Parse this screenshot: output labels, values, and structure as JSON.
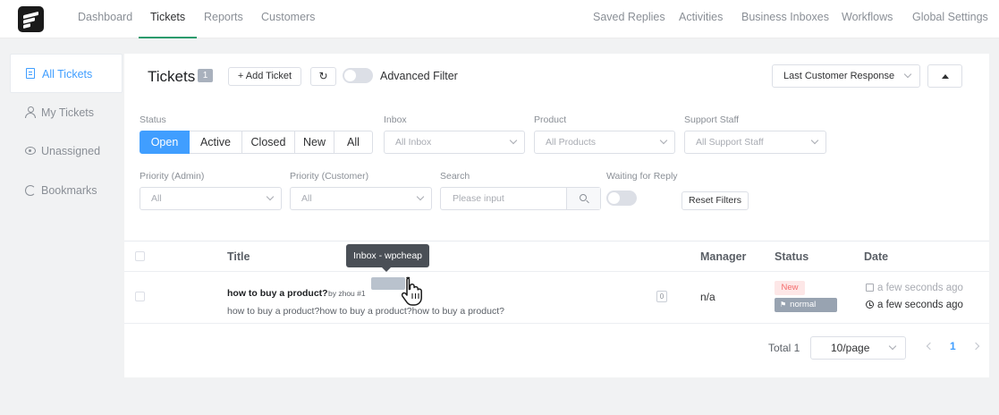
{
  "nav": {
    "items": [
      {
        "label": "Dashboard",
        "active": false
      },
      {
        "label": "Tickets",
        "active": true
      },
      {
        "label": "Reports",
        "active": false
      },
      {
        "label": "Customers",
        "active": false
      }
    ],
    "right_items": [
      {
        "label": "Saved Replies"
      },
      {
        "label": "Activities"
      },
      {
        "label": "Business Inboxes"
      },
      {
        "label": "Workflows"
      },
      {
        "label": "Global Settings"
      }
    ]
  },
  "sidebar": {
    "items": [
      {
        "label": "All Tickets",
        "icon": "document-icon",
        "active": true
      },
      {
        "label": "My Tickets",
        "icon": "user-icon",
        "active": false
      },
      {
        "label": "Unassigned",
        "icon": "eye-icon",
        "active": false
      },
      {
        "label": "Bookmarks",
        "icon": "bookmark-icon",
        "active": false
      }
    ]
  },
  "header": {
    "title": "Tickets",
    "count": "1",
    "add_ticket_label": "+ Add Ticket",
    "refresh_glyph": "↻",
    "advanced_filter_label": "Advanced Filter",
    "sort_by": "Last Customer Response"
  },
  "filters": {
    "status_label": "Status",
    "status_options": [
      "Open",
      "Active",
      "Closed",
      "New",
      "All"
    ],
    "status_selected": "Open",
    "inbox_label": "Inbox",
    "inbox_value": "All Inbox",
    "product_label": "Product",
    "product_value": "All Products",
    "staff_label": "Support Staff",
    "staff_value": "All Support Staff",
    "priority_admin_label": "Priority (Admin)",
    "priority_admin_value": "All",
    "priority_customer_label": "Priority (Customer)",
    "priority_customer_value": "All",
    "search_label": "Search",
    "search_placeholder": "Please input",
    "waiting_label": "Waiting for Reply",
    "reset_label": "Reset Filters"
  },
  "table": {
    "columns": {
      "title": "Title",
      "manager": "Manager",
      "status": "Status",
      "date": "Date"
    },
    "rows": [
      {
        "title": "how to buy a product?",
        "by": "by zhou #1",
        "message": "how to buy a product?how to buy a product?how to buy a product?",
        "responses": "0",
        "manager": "n/a",
        "status": "New",
        "priority": "normal",
        "date_customer": "a few seconds ago",
        "date_updated": "a few seconds ago"
      }
    ]
  },
  "pagination": {
    "total": "Total 1",
    "page_size": "10/page",
    "current_page": "1"
  },
  "tooltip": {
    "text": "Inbox - wpcheap"
  },
  "colors": {
    "accent": "#409eff",
    "nav_active": "#2b9b6d",
    "new_tag": "#f56c6c"
  }
}
